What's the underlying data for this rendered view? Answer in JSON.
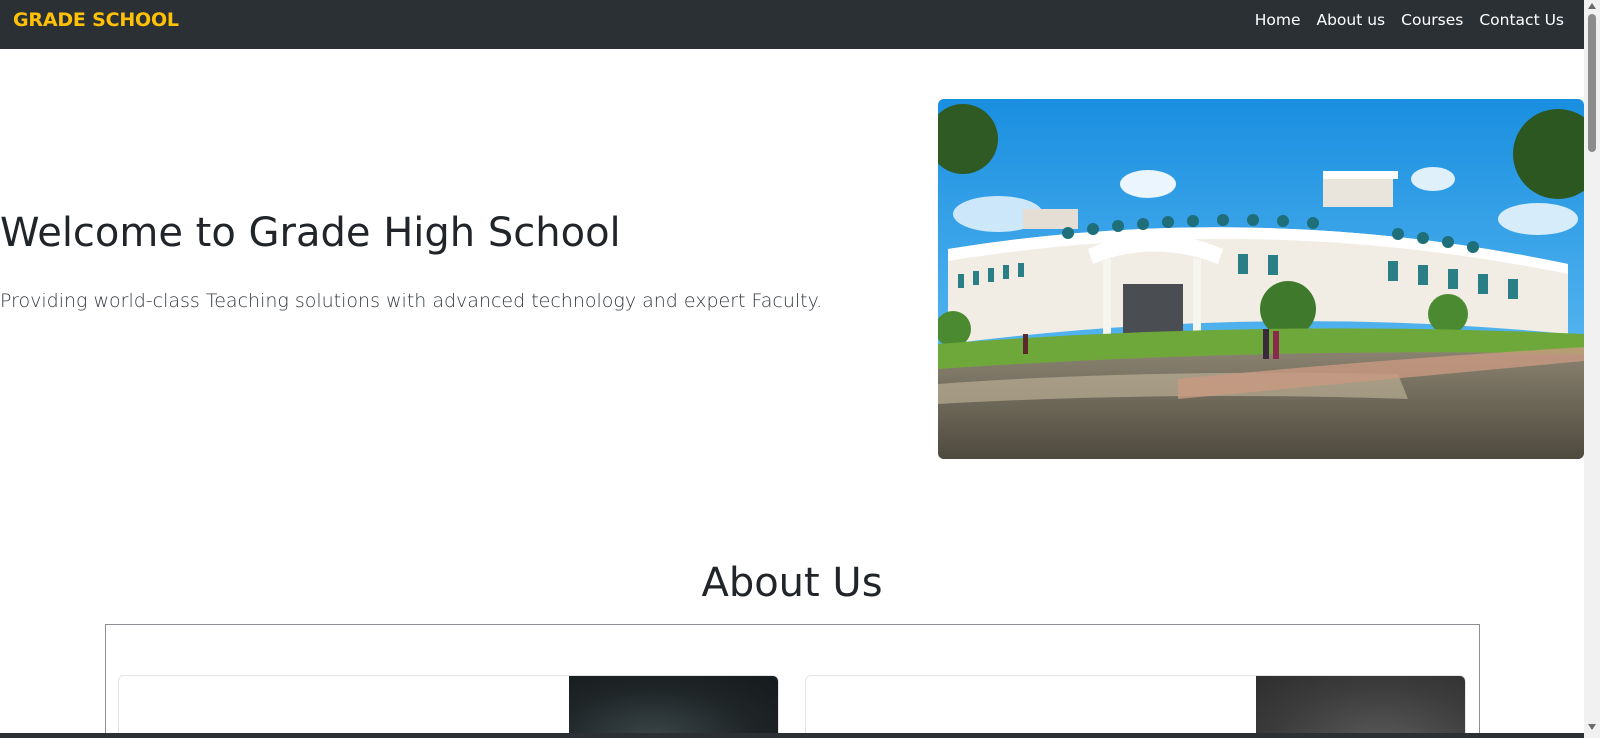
{
  "navbar": {
    "brand": "GRADE SCHOOL",
    "links": [
      "Home",
      "About us",
      "Courses",
      "Contact Us"
    ]
  },
  "hero": {
    "title": "Welcome to Grade High School",
    "subtitle": "Providing world-class Teaching solutions with advanced technology and expert Faculty."
  },
  "about": {
    "title": "About Us"
  },
  "colors": {
    "navbar_bg": "#2b3035",
    "brand": "#ffc107",
    "text": "#212529"
  }
}
